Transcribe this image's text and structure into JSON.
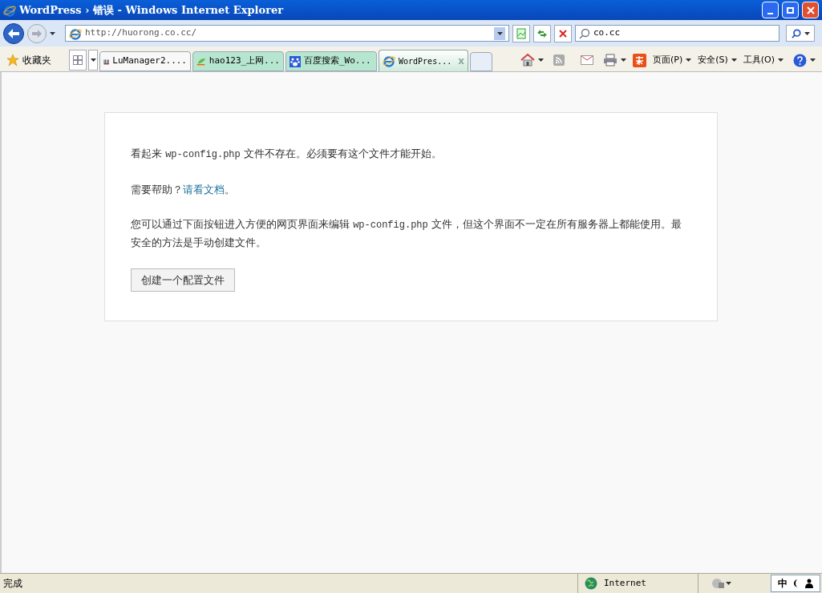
{
  "window": {
    "title": "WordPress › 错误 - Windows Internet Explorer"
  },
  "address_bar": {
    "url": "http://huorong.co.cc/"
  },
  "search": {
    "value": "co.cc"
  },
  "favorites": {
    "label": "收藏夹"
  },
  "tabs": [
    {
      "label": "LuManager2....",
      "kind": "lu",
      "selected": false
    },
    {
      "label": "hao123_上网...",
      "kind": "hao",
      "selected": false
    },
    {
      "label": "百度搜索_Wo...",
      "kind": "paw",
      "selected": false
    },
    {
      "label": "WordPres...",
      "kind": "ie",
      "selected": true,
      "close": "x"
    }
  ],
  "command_bar": [
    {
      "label": "页面(P)"
    },
    {
      "label": "安全(S)"
    },
    {
      "label": "工具(O)"
    }
  ],
  "page": {
    "paragraphs": [
      [
        {
          "kind": "text",
          "text": "看起来 "
        },
        {
          "kind": "code",
          "text": "wp-config.php"
        },
        {
          "kind": "text",
          "text": " 文件不存在。必须要有这个文件才能开始。"
        }
      ],
      [
        {
          "kind": "text",
          "text": "需要帮助？"
        },
        {
          "kind": "link",
          "text": "请看文档"
        },
        {
          "kind": "text",
          "text": "。"
        }
      ],
      [
        {
          "kind": "text",
          "text": "您可以通过下面按钮进入方便的网页界面来编辑 "
        },
        {
          "kind": "code",
          "text": "wp-config.php"
        },
        {
          "kind": "text",
          "text": " 文件，但这个界面不一定在所有服务器上都能使用。最安全的方法是手动创建文件。"
        }
      ]
    ],
    "button": "创建一个配置文件"
  },
  "status_bar": {
    "status": "完成",
    "zone": "Internet"
  },
  "ime": {
    "mode": "中"
  }
}
